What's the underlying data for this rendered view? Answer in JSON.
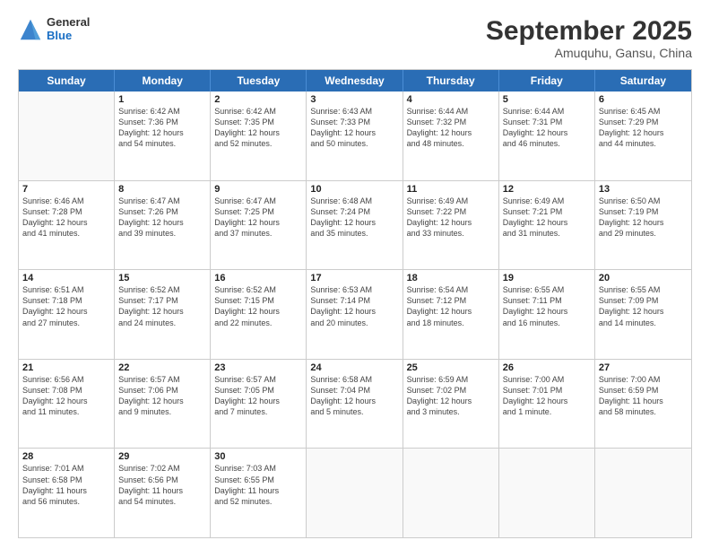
{
  "header": {
    "logo_line1": "General",
    "logo_line2": "Blue",
    "title": "September 2025",
    "subtitle": "Amuquhu, Gansu, China"
  },
  "weekdays": [
    "Sunday",
    "Monday",
    "Tuesday",
    "Wednesday",
    "Thursday",
    "Friday",
    "Saturday"
  ],
  "weeks": [
    [
      {
        "day": "",
        "lines": []
      },
      {
        "day": "1",
        "lines": [
          "Sunrise: 6:42 AM",
          "Sunset: 7:36 PM",
          "Daylight: 12 hours",
          "and 54 minutes."
        ]
      },
      {
        "day": "2",
        "lines": [
          "Sunrise: 6:42 AM",
          "Sunset: 7:35 PM",
          "Daylight: 12 hours",
          "and 52 minutes."
        ]
      },
      {
        "day": "3",
        "lines": [
          "Sunrise: 6:43 AM",
          "Sunset: 7:33 PM",
          "Daylight: 12 hours",
          "and 50 minutes."
        ]
      },
      {
        "day": "4",
        "lines": [
          "Sunrise: 6:44 AM",
          "Sunset: 7:32 PM",
          "Daylight: 12 hours",
          "and 48 minutes."
        ]
      },
      {
        "day": "5",
        "lines": [
          "Sunrise: 6:44 AM",
          "Sunset: 7:31 PM",
          "Daylight: 12 hours",
          "and 46 minutes."
        ]
      },
      {
        "day": "6",
        "lines": [
          "Sunrise: 6:45 AM",
          "Sunset: 7:29 PM",
          "Daylight: 12 hours",
          "and 44 minutes."
        ]
      }
    ],
    [
      {
        "day": "7",
        "lines": [
          "Sunrise: 6:46 AM",
          "Sunset: 7:28 PM",
          "Daylight: 12 hours",
          "and 41 minutes."
        ]
      },
      {
        "day": "8",
        "lines": [
          "Sunrise: 6:47 AM",
          "Sunset: 7:26 PM",
          "Daylight: 12 hours",
          "and 39 minutes."
        ]
      },
      {
        "day": "9",
        "lines": [
          "Sunrise: 6:47 AM",
          "Sunset: 7:25 PM",
          "Daylight: 12 hours",
          "and 37 minutes."
        ]
      },
      {
        "day": "10",
        "lines": [
          "Sunrise: 6:48 AM",
          "Sunset: 7:24 PM",
          "Daylight: 12 hours",
          "and 35 minutes."
        ]
      },
      {
        "day": "11",
        "lines": [
          "Sunrise: 6:49 AM",
          "Sunset: 7:22 PM",
          "Daylight: 12 hours",
          "and 33 minutes."
        ]
      },
      {
        "day": "12",
        "lines": [
          "Sunrise: 6:49 AM",
          "Sunset: 7:21 PM",
          "Daylight: 12 hours",
          "and 31 minutes."
        ]
      },
      {
        "day": "13",
        "lines": [
          "Sunrise: 6:50 AM",
          "Sunset: 7:19 PM",
          "Daylight: 12 hours",
          "and 29 minutes."
        ]
      }
    ],
    [
      {
        "day": "14",
        "lines": [
          "Sunrise: 6:51 AM",
          "Sunset: 7:18 PM",
          "Daylight: 12 hours",
          "and 27 minutes."
        ]
      },
      {
        "day": "15",
        "lines": [
          "Sunrise: 6:52 AM",
          "Sunset: 7:17 PM",
          "Daylight: 12 hours",
          "and 24 minutes."
        ]
      },
      {
        "day": "16",
        "lines": [
          "Sunrise: 6:52 AM",
          "Sunset: 7:15 PM",
          "Daylight: 12 hours",
          "and 22 minutes."
        ]
      },
      {
        "day": "17",
        "lines": [
          "Sunrise: 6:53 AM",
          "Sunset: 7:14 PM",
          "Daylight: 12 hours",
          "and 20 minutes."
        ]
      },
      {
        "day": "18",
        "lines": [
          "Sunrise: 6:54 AM",
          "Sunset: 7:12 PM",
          "Daylight: 12 hours",
          "and 18 minutes."
        ]
      },
      {
        "day": "19",
        "lines": [
          "Sunrise: 6:55 AM",
          "Sunset: 7:11 PM",
          "Daylight: 12 hours",
          "and 16 minutes."
        ]
      },
      {
        "day": "20",
        "lines": [
          "Sunrise: 6:55 AM",
          "Sunset: 7:09 PM",
          "Daylight: 12 hours",
          "and 14 minutes."
        ]
      }
    ],
    [
      {
        "day": "21",
        "lines": [
          "Sunrise: 6:56 AM",
          "Sunset: 7:08 PM",
          "Daylight: 12 hours",
          "and 11 minutes."
        ]
      },
      {
        "day": "22",
        "lines": [
          "Sunrise: 6:57 AM",
          "Sunset: 7:06 PM",
          "Daylight: 12 hours",
          "and 9 minutes."
        ]
      },
      {
        "day": "23",
        "lines": [
          "Sunrise: 6:57 AM",
          "Sunset: 7:05 PM",
          "Daylight: 12 hours",
          "and 7 minutes."
        ]
      },
      {
        "day": "24",
        "lines": [
          "Sunrise: 6:58 AM",
          "Sunset: 7:04 PM",
          "Daylight: 12 hours",
          "and 5 minutes."
        ]
      },
      {
        "day": "25",
        "lines": [
          "Sunrise: 6:59 AM",
          "Sunset: 7:02 PM",
          "Daylight: 12 hours",
          "and 3 minutes."
        ]
      },
      {
        "day": "26",
        "lines": [
          "Sunrise: 7:00 AM",
          "Sunset: 7:01 PM",
          "Daylight: 12 hours",
          "and 1 minute."
        ]
      },
      {
        "day": "27",
        "lines": [
          "Sunrise: 7:00 AM",
          "Sunset: 6:59 PM",
          "Daylight: 11 hours",
          "and 58 minutes."
        ]
      }
    ],
    [
      {
        "day": "28",
        "lines": [
          "Sunrise: 7:01 AM",
          "Sunset: 6:58 PM",
          "Daylight: 11 hours",
          "and 56 minutes."
        ]
      },
      {
        "day": "29",
        "lines": [
          "Sunrise: 7:02 AM",
          "Sunset: 6:56 PM",
          "Daylight: 11 hours",
          "and 54 minutes."
        ]
      },
      {
        "day": "30",
        "lines": [
          "Sunrise: 7:03 AM",
          "Sunset: 6:55 PM",
          "Daylight: 11 hours",
          "and 52 minutes."
        ]
      },
      {
        "day": "",
        "lines": []
      },
      {
        "day": "",
        "lines": []
      },
      {
        "day": "",
        "lines": []
      },
      {
        "day": "",
        "lines": []
      }
    ]
  ]
}
